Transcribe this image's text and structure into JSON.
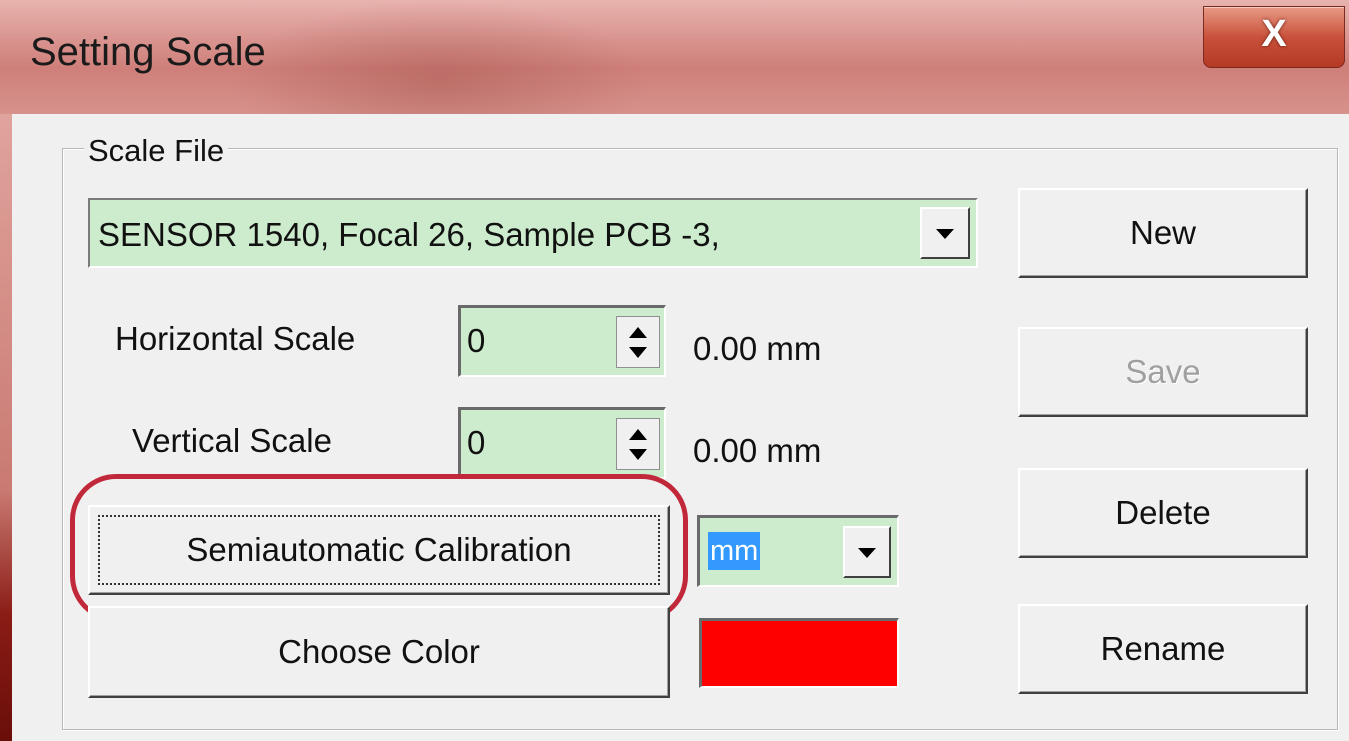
{
  "window": {
    "title": "Setting Scale",
    "close_label": "X"
  },
  "group": {
    "legend": "Scale File"
  },
  "scale_file": {
    "selected": "SENSOR 1540, Focal 26,  Sample PCB -3,"
  },
  "horizontal": {
    "label": "Horizontal Scale",
    "value": "0",
    "readout": "0.00 mm"
  },
  "vertical": {
    "label": "Vertical Scale",
    "value": "0",
    "readout": "0.00 mm"
  },
  "buttons": {
    "new": "New",
    "save": "Save",
    "delete": "Delete",
    "rename": "Rename",
    "semiautomatic": "Semiautomatic Calibration",
    "choose_color": "Choose Color"
  },
  "unit": {
    "selected": "mm"
  },
  "colors": {
    "field_bg": "#cdeccd",
    "selected_color": "#ff0000",
    "highlight_annotation": "#c1283a",
    "titlebar": "#d9948f"
  },
  "icons": {
    "close": "close-icon",
    "dropdown": "chevron-down-icon",
    "spin": "spin-updown-icon"
  }
}
